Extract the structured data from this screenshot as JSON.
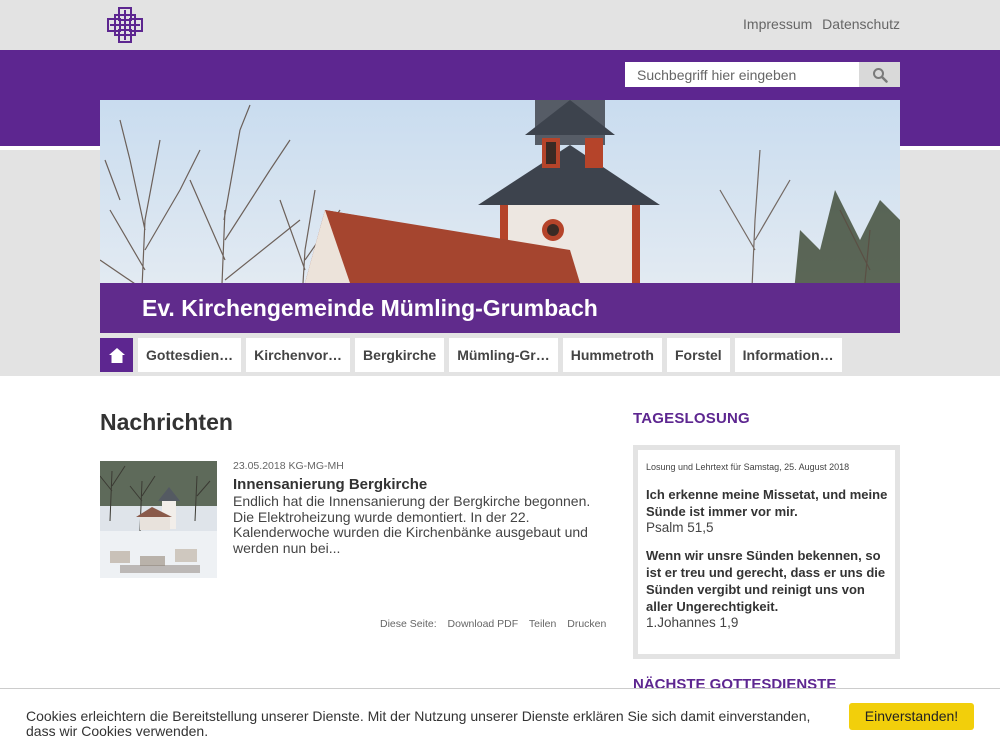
{
  "header": {
    "links": [
      "Impressum",
      "Datenschutz"
    ]
  },
  "search": {
    "placeholder": "Suchbegriff hier eingeben"
  },
  "hero": {
    "title": "Ev. Kirchengemeinde Mümling-Grumbach"
  },
  "nav": {
    "items": [
      "Gottesdien…",
      "Kirchenvor…",
      "Bergkirche",
      "Mümling-Gr…",
      "Hummetroth",
      "Forstel",
      "Information…"
    ]
  },
  "main": {
    "heading": "Nachrichten",
    "news": [
      {
        "meta": "23.05.2018 KG-MG-MH",
        "title": "Innensanierung Bergkirche",
        "teaser": "Endlich hat die Innensanierung der Bergkirche begonnen. Die Elektroheizung wurde demontiert. In der 22. Kalenderwoche wurden die Kirchenbänke ausgebaut und werden nun bei..."
      }
    ],
    "page_actions": {
      "label": "Diese Seite:",
      "download": "Download PDF",
      "share": "Teilen",
      "print": "Drucken"
    }
  },
  "sidebar": {
    "losung_heading": "TAGESLOSUNG",
    "losung_head": "Losung und Lehrtext für Samstag, 25. August 2018",
    "verse1": "Ich erkenne meine Missetat, und meine Sünde ist immer vor mir.",
    "ref1": "Psalm 51,5",
    "verse2": "Wenn wir unsre Sünden bekennen, so ist er treu und gerecht, dass er uns die Sünden vergibt und reinigt uns von aller Ungerechtigkeit.",
    "ref2": "1.Johannes 1,9",
    "next_heading": "NÄCHSTE GOTTESDIENSTE"
  },
  "cookie": {
    "text": "Cookies erleichtern die Bereitstellung unserer Dienste. Mit der Nutzung unserer Dienste erklären Sie sich damit einverstanden, dass wir Cookies verwenden.",
    "button": "Einverstanden!"
  },
  "colors": {
    "brand": "#5d2690",
    "gray": "#e3e3e3",
    "cookie_button": "#f2cf0b"
  }
}
